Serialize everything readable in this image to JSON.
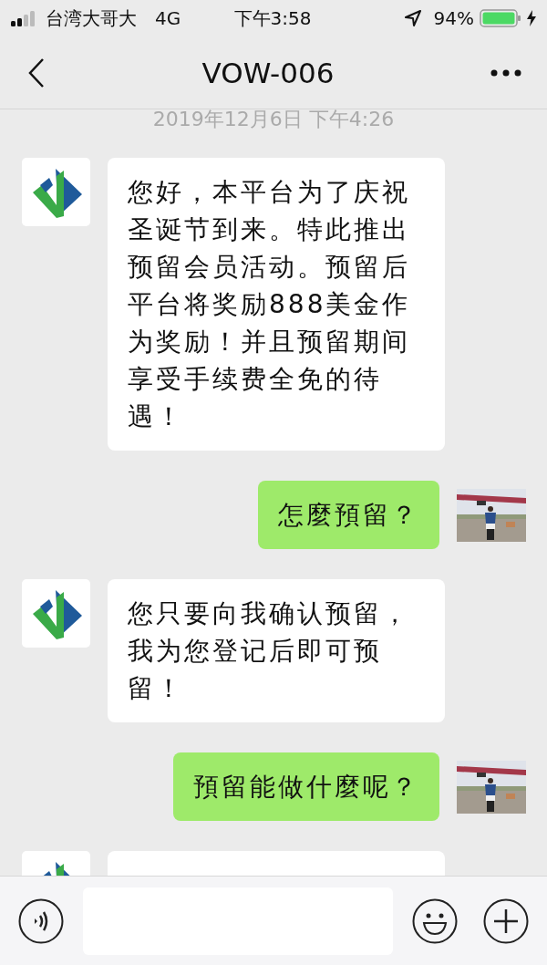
{
  "status_bar": {
    "carrier": "台湾大哥大",
    "network": "4G",
    "time": "下午3:58",
    "battery": "94%"
  },
  "header": {
    "title": "VOW-006"
  },
  "timestamp": "2019年12月6日 下午4:26",
  "messages": [
    {
      "kind": "received",
      "text": "您好，本平台为了庆祝圣诞节到来。特此推出预留会员活动。预留后平台将奖励888美金作为奖励！并且预留期间享受手续费全免的待遇！"
    },
    {
      "kind": "sent",
      "text": "怎麼預留？"
    },
    {
      "kind": "received",
      "text": "您只要向我确认预留，我为您登记后即可预留！"
    },
    {
      "kind": "sent",
      "text": "預留能做什麼呢？"
    },
    {
      "kind": "received"
    }
  ]
}
